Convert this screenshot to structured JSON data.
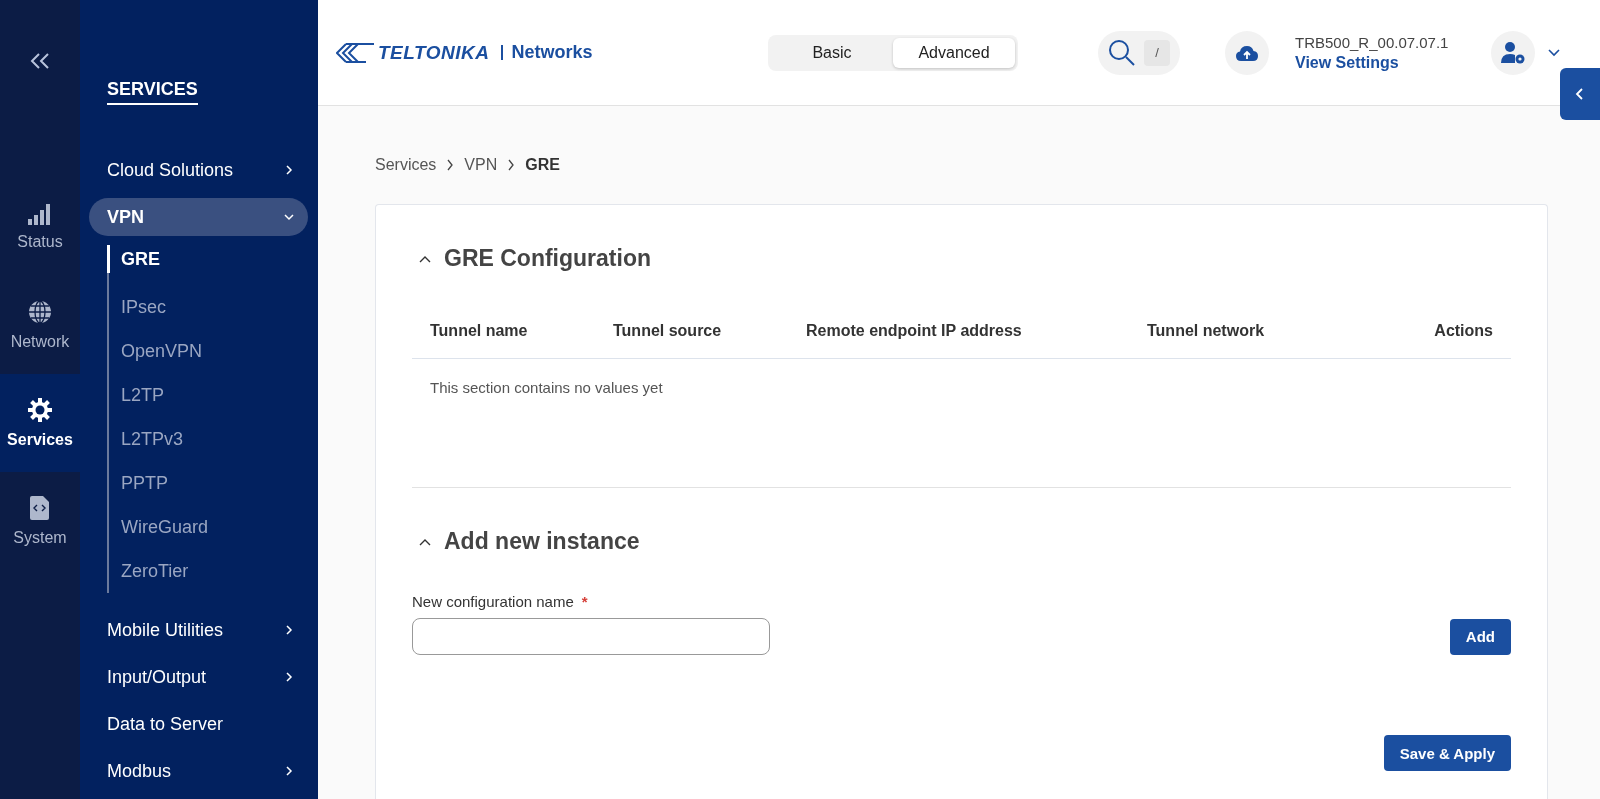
{
  "rail": {
    "items": [
      {
        "label": "Status",
        "kind": "signal",
        "selected": false
      },
      {
        "label": "Network",
        "kind": "globe",
        "selected": false
      },
      {
        "label": "Services",
        "kind": "gear",
        "selected": true
      },
      {
        "label": "System",
        "kind": "file",
        "selected": false
      }
    ]
  },
  "sidebar": {
    "title": "SERVICES",
    "items": [
      {
        "label": "Cloud Solutions",
        "expandable": true,
        "expanded": false,
        "selected": false
      },
      {
        "label": "VPN",
        "expandable": true,
        "expanded": true,
        "selected": true,
        "children": [
          {
            "label": "GRE",
            "selected": true
          },
          {
            "label": "IPsec",
            "selected": false
          },
          {
            "label": "OpenVPN",
            "selected": false
          },
          {
            "label": "L2TP",
            "selected": false
          },
          {
            "label": "L2TPv3",
            "selected": false
          },
          {
            "label": "PPTP",
            "selected": false
          },
          {
            "label": "WireGuard",
            "selected": false
          },
          {
            "label": "ZeroTier",
            "selected": false
          }
        ]
      },
      {
        "label": "Mobile Utilities",
        "expandable": true,
        "expanded": false,
        "selected": false
      },
      {
        "label": "Input/Output",
        "expandable": true,
        "expanded": false,
        "selected": false
      },
      {
        "label": "Data to Server",
        "expandable": false,
        "selected": false
      },
      {
        "label": "Modbus",
        "expandable": true,
        "expanded": false,
        "selected": false
      }
    ]
  },
  "header": {
    "logo": {
      "brand": "TELTONIKA",
      "product": "Networks"
    },
    "mode_tabs": [
      {
        "label": "Basic",
        "selected": false
      },
      {
        "label": "Advanced",
        "selected": true
      }
    ],
    "search": {
      "shortcut": "/"
    },
    "device": {
      "firmware": "TRB500_R_00.07.07.1",
      "link": "View Settings"
    }
  },
  "breadcrumbs": [
    {
      "label": "Services",
      "current": false
    },
    {
      "label": "VPN",
      "current": false
    },
    {
      "label": "GRE",
      "current": true
    }
  ],
  "gre_section": {
    "title": "GRE Configuration",
    "expanded": true,
    "table": {
      "columns": [
        "Tunnel name",
        "Tunnel source",
        "Remote endpoint IP address",
        "Tunnel network",
        "Actions"
      ],
      "empty_message": "This section contains no values yet"
    }
  },
  "add_section": {
    "title": "Add new instance",
    "expanded": true,
    "field": {
      "label": "New configuration name",
      "required": true,
      "required_mark": "*"
    },
    "add_button": "Add"
  },
  "save_button": "Save & Apply"
}
